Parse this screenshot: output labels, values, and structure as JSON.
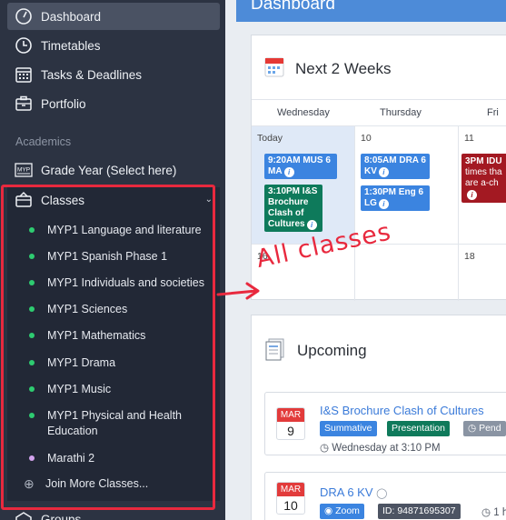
{
  "nav": {
    "items": [
      {
        "label": "Dashboard",
        "icon": "gauge-icon"
      },
      {
        "label": "Timetables",
        "icon": "clock-icon"
      },
      {
        "label": "Tasks & Deadlines",
        "icon": "calendar-grid-icon"
      },
      {
        "label": "Portfolio",
        "icon": "portfolio-icon"
      }
    ],
    "section_label": "Academics",
    "grade_year": {
      "label": "Grade Year (Select here)",
      "badge": "MYP"
    },
    "classes": {
      "label": "Classes",
      "items": [
        "MYP1 Language and literature",
        "MYP1 Spanish Phase 1",
        "MYP1 Individuals and societies",
        "MYP1 Sciences",
        "MYP1 Mathematics",
        "MYP1 Drama",
        "MYP1 Music",
        "MYP1 Physical and Health Education",
        "Marathi 2"
      ],
      "join": "Join More Classes..."
    },
    "groups_label": "Groups"
  },
  "header": {
    "title": "Dashboard"
  },
  "calendar": {
    "title": "Next 2 Weeks",
    "days": [
      "Wednesday",
      "Thursday",
      "Fri"
    ],
    "row1": {
      "c1_date": "Today",
      "c2_date": "10",
      "c3_date": "11",
      "events": {
        "e1": "9:20AM MUS 6 MA",
        "e2": "3:10PM I&S Brochure Clash of Cultures",
        "e3": "8:05AM DRA 6 KV",
        "e4": "1:30PM Eng 6 LG",
        "e5_time": "3PM IDU",
        "e5_rest": "times tha are a-ch"
      }
    },
    "row2": {
      "c1_date": "16",
      "c3_date": "18"
    }
  },
  "upcoming": {
    "title": "Upcoming",
    "items": [
      {
        "month": "MAR",
        "day": "9",
        "title": "I&S Brochure Clash of Cultures",
        "tags": [
          "Summative",
          "Presentation",
          "Pend"
        ],
        "meta": "Wednesday at 3:10 PM"
      },
      {
        "month": "MAR",
        "day": "10",
        "title": "DRA 6 KV",
        "tags": [
          "Zoom",
          "ID: 94871695307"
        ],
        "meta": "1 h"
      }
    ]
  },
  "annotation": "All classes",
  "colors": {
    "sidebar": "#2c3342",
    "highlight": "#e8293e",
    "primary": "#4d8bd8",
    "event_blue": "#3b84e0",
    "event_green": "#0e7a5b",
    "event_red": "#a31922"
  }
}
